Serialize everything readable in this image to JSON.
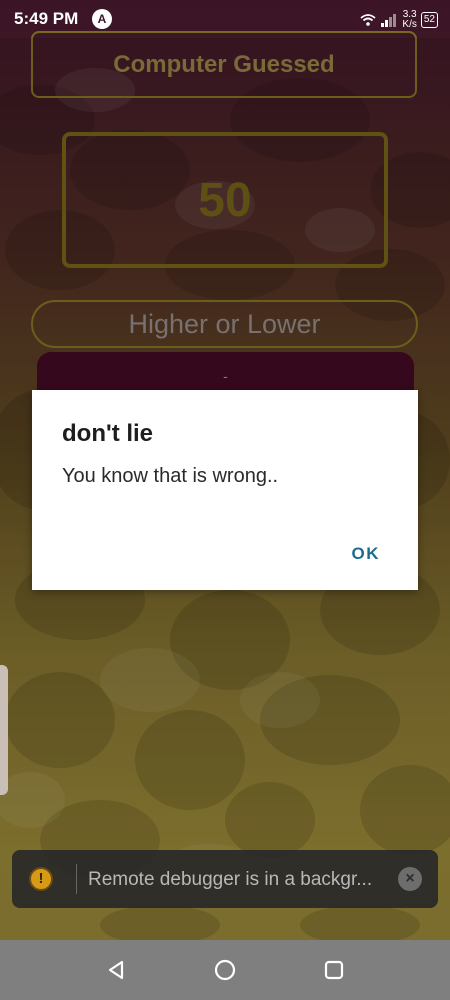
{
  "status_bar": {
    "time": "5:49 PM",
    "notification_badge": "A",
    "network_speed_value": "3.3",
    "network_speed_unit": "K/s",
    "battery": "52"
  },
  "game": {
    "title": "Computer Guessed",
    "guess": "50",
    "prompt": "Higher or Lower",
    "minus_label": "-"
  },
  "dialog": {
    "title": "don't lie",
    "message": "You know that is wrong..",
    "ok_label": "OK"
  },
  "toast": {
    "message": "Remote debugger is in a backgr..."
  },
  "icons": {
    "wifi": "wifi-icon",
    "signal": "signal-icon",
    "warning": "warning-icon",
    "close": "close-icon",
    "back": "back-icon",
    "home": "home-icon",
    "recents": "recents-icon"
  },
  "colors": {
    "dialog_accent": "#1f6b8e",
    "border_gold": "#7a6a1e",
    "button_maroon": "#3e0a22"
  }
}
